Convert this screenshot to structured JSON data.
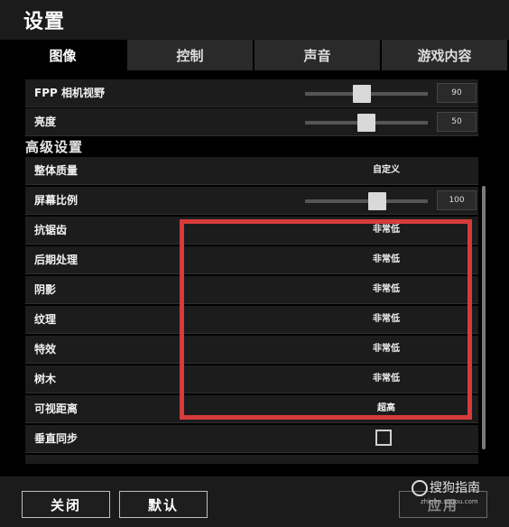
{
  "window": {
    "title": "设置"
  },
  "tabs": [
    {
      "label": "图像",
      "active": true
    },
    {
      "label": "控制",
      "active": false
    },
    {
      "label": "声音",
      "active": false
    },
    {
      "label": "游戏内容",
      "active": false
    }
  ],
  "settings": {
    "fov": {
      "label": "FPP 相机视野",
      "value": "90",
      "level": 0.46
    },
    "brightness": {
      "label": "亮度",
      "value": "50",
      "level": 0.5
    },
    "advanced_heading": "高级设置",
    "overall_quality": {
      "label": "整体质量",
      "value": "自定义"
    },
    "screen_scale": {
      "label": "屏幕比例",
      "value": "100",
      "level": 0.6
    },
    "anti_aliasing": {
      "label": "抗锯齿",
      "value": "非常低"
    },
    "post_processing": {
      "label": "后期处理",
      "value": "非常低"
    },
    "shadows": {
      "label": "阴影",
      "value": "非常低"
    },
    "textures": {
      "label": "纹理",
      "value": "非常低"
    },
    "effects": {
      "label": "特效",
      "value": "非常低"
    },
    "foliage": {
      "label": "树木",
      "value": "非常低"
    },
    "view_distance": {
      "label": "可视距离",
      "value": "超高"
    },
    "vsync": {
      "label": "垂直同步",
      "checked": false
    }
  },
  "footer": {
    "close_label": "关闭",
    "default_label": "默认",
    "apply_label": "应用"
  },
  "watermark": {
    "text": "搜狗指南",
    "url": "zhinan.sogou.com"
  },
  "colors": {
    "highlight": "#d53b3b",
    "background": "#000000"
  }
}
